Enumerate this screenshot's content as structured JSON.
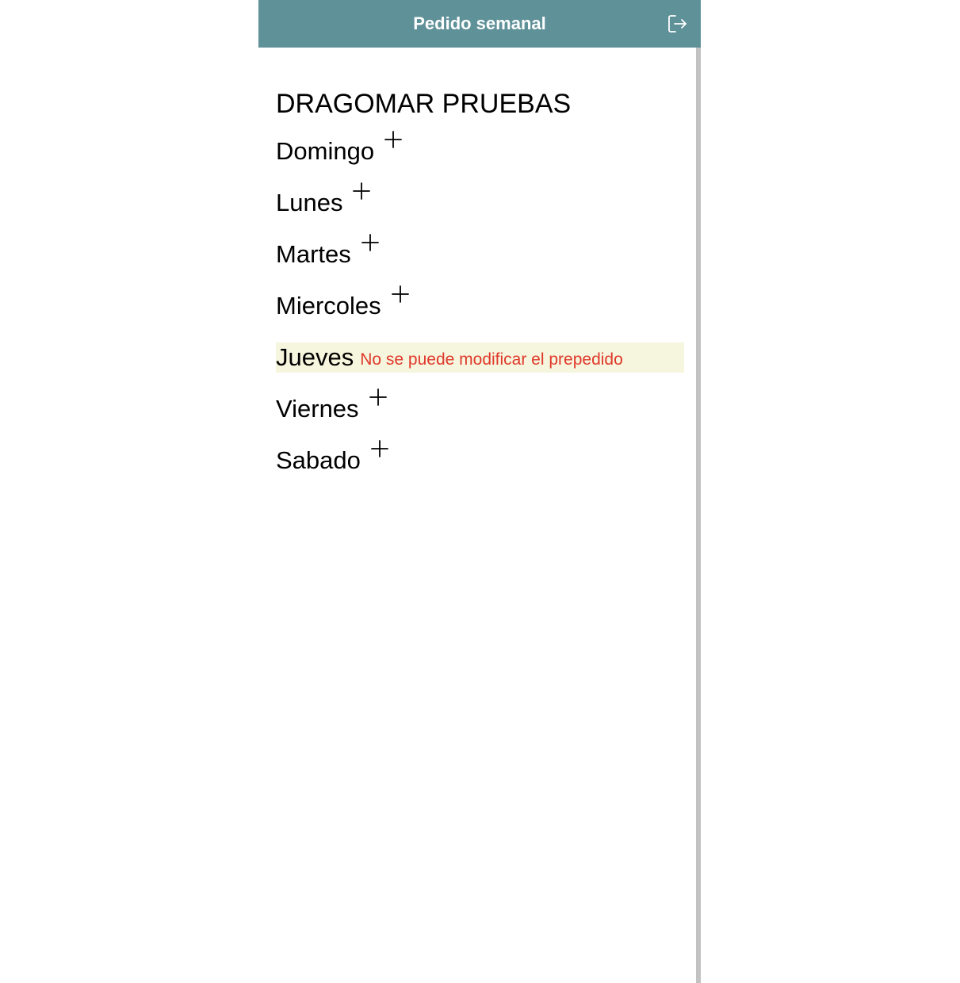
{
  "header": {
    "title": "Pedido semanal",
    "logout_icon": "logout-icon"
  },
  "main": {
    "company": "DRAGOMAR PRUEBAS",
    "days": [
      {
        "label": "Domingo",
        "action_icon": "plus-icon"
      },
      {
        "label": "Lunes",
        "action_icon": "plus-icon"
      },
      {
        "label": "Martes",
        "action_icon": "plus-icon"
      },
      {
        "label": "Miercoles",
        "action_icon": "plus-icon"
      },
      {
        "label": "Jueves",
        "message": "No se puede modificar el prepedido"
      },
      {
        "label": "Viernes",
        "action_icon": "plus-icon"
      },
      {
        "label": "Sabado",
        "action_icon": "plus-icon"
      }
    ]
  },
  "colors": {
    "header_bg": "#5f9198",
    "header_text": "#ffffff",
    "locked_bg": "#f6f5dd",
    "locked_text": "#e0392b",
    "scrollbar": "#c2c2c2"
  }
}
